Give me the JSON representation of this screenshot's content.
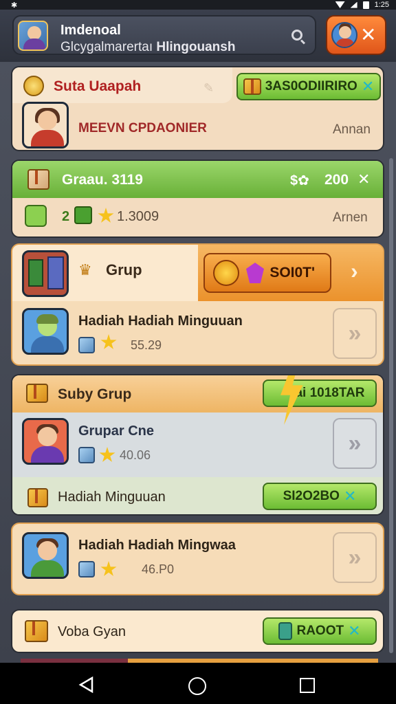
{
  "status_bar": {
    "time": "1:25"
  },
  "header": {
    "title": "Imdenoal",
    "subtitle_plain": "Glcygalmarertaı",
    "subtitle_bold": "Hlingouansh"
  },
  "cards": {
    "profile": {
      "title": "Suta Uaapah",
      "name": "MEEVN CPDAONIER",
      "action_label": "3AS0ODIIRIRO",
      "right_text": "Annan"
    },
    "green_header": {
      "title": "Graau. 3119",
      "reward": "200",
      "stat_count": "2",
      "stat_value": "1.3009",
      "right_text": "Arnen"
    },
    "grup": {
      "title": "Grup",
      "action_label": "SOI0T'",
      "item_title": "Hadiah Hadiah  Minguuan",
      "item_value": "55.29"
    },
    "sub_grup": {
      "title": "Suby Grup",
      "action_label": "ai 1018TAR",
      "item_title": "Grupar Cne",
      "item_value": "40.06",
      "reward_title": "Hadiah  Minguuan",
      "reward_label": "SI2O2BO"
    },
    "weekly": {
      "item_title": "Hadiah Hadiah  Mingwaa",
      "item_value": "46.P0"
    },
    "bottom": {
      "title": "Voba Gyan",
      "action_label": "RAOOT"
    }
  },
  "colors": {
    "accent_green": "#7cc43c",
    "accent_orange": "#ef8a22",
    "card_cream": "#f3dcc0",
    "title_red": "#b02020"
  }
}
